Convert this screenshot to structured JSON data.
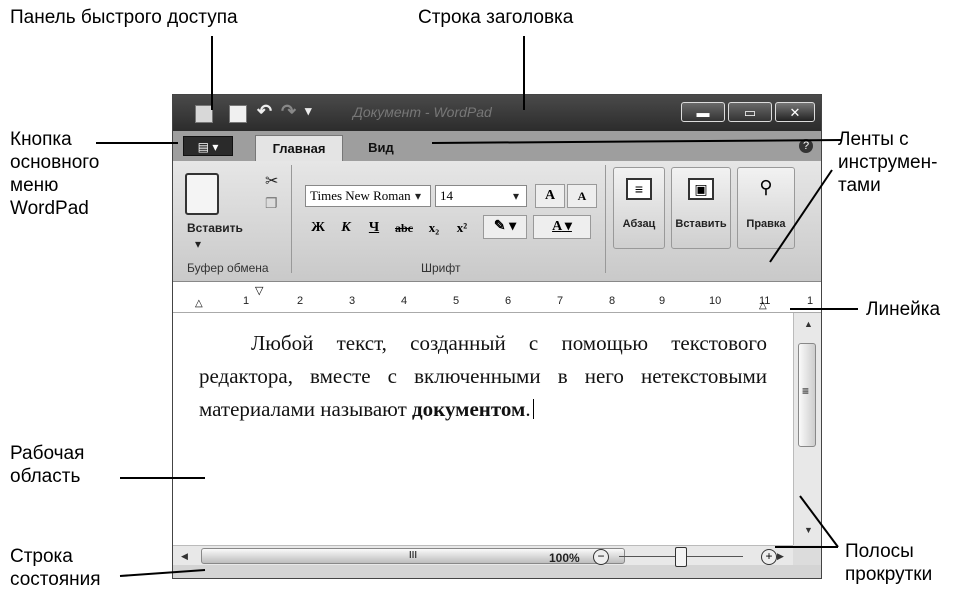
{
  "annotations": {
    "quick_access": "Панель быстрого доступа",
    "title_bar": "Строка заголовка",
    "main_menu_button": "Кнопка\nосновного\nменю\nWordPad",
    "ribbons": "Ленты с\nинструмен-\nтами",
    "ruler": "Линейка",
    "work_area": "Рабочая\nобласть",
    "status_bar": "Строка\nсостояния",
    "scrollbars": "Полосы\nпрокрутки"
  },
  "window": {
    "title": "Документ - WordPad",
    "tabs": [
      "Главная",
      "Вид"
    ],
    "help": "?"
  },
  "ribbon": {
    "paste_label": "Вставить",
    "clipboard_group": "Буфер обмена",
    "font_name": "Times New Roman",
    "font_size": "14",
    "font_group": "Шрифт",
    "bold": "Ж",
    "italic": "К",
    "underline": "Ч",
    "strike": "abc",
    "subscript": "x₂",
    "superscript": "x²",
    "grow_font": "A",
    "shrink_font": "A",
    "color_a": "A",
    "paragraph_label": "Абзац",
    "insert_label": "Вставить",
    "edit_label": "Правка"
  },
  "ruler": {
    "ticks": [
      "1",
      "2",
      "3",
      "4",
      "5",
      "6",
      "7",
      "8",
      "9",
      "10",
      "11",
      "1"
    ]
  },
  "document": {
    "text_normal": "Любой текст, созданный с помощью текстового редактора, вместе с включенными в него нетекстовыми материалами называют ",
    "text_bold": "документом",
    "text_end": "."
  },
  "status": {
    "zoom": "100%",
    "zoom_out": "−",
    "zoom_in": "+"
  },
  "scroll": {
    "h_grip": "III",
    "v_grip": "≡"
  }
}
